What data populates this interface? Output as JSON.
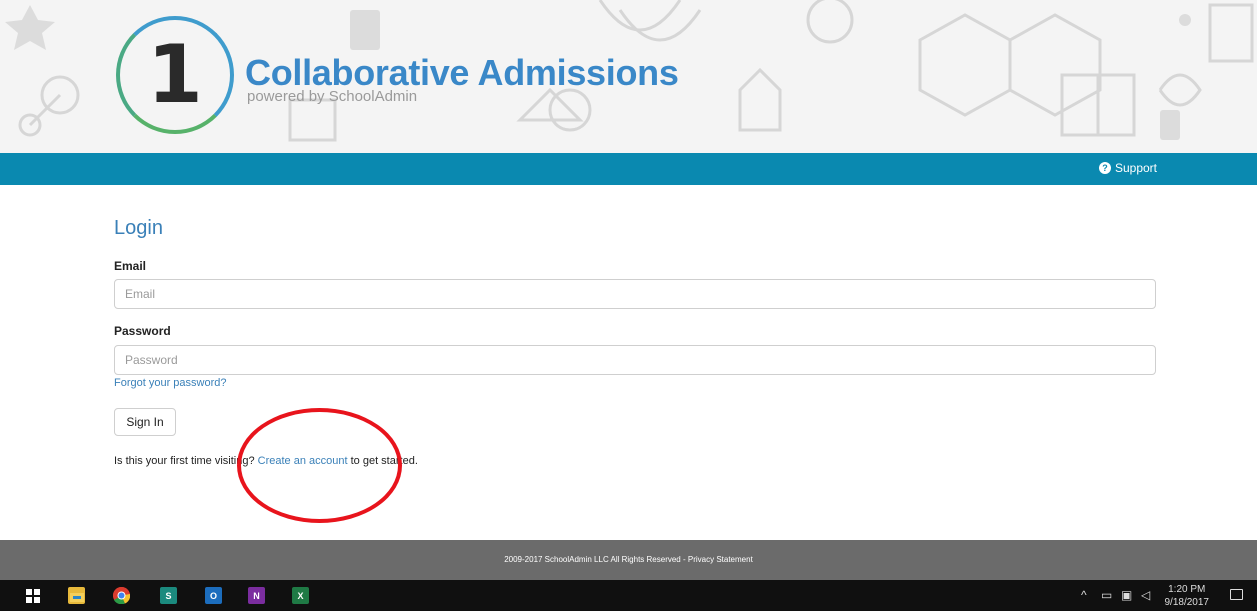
{
  "brand": {
    "logo_number": "1",
    "title": "Collaborative Admissions",
    "subtitle": "powered by SchoolAdmin"
  },
  "nav": {
    "support_label": "Support",
    "support_icon": "question-circle-icon"
  },
  "login": {
    "title": "Login",
    "email_label": "Email",
    "email_placeholder": "Email",
    "email_value": "",
    "password_label": "Password",
    "password_placeholder": "Password",
    "password_value": "",
    "forgot_link": "Forgot your password?",
    "signin_button": "Sign In",
    "first_time_prefix": "Is this your first time visiting?",
    "create_account_link": "Create an account",
    "first_time_suffix": "to get started."
  },
  "footer": {
    "copyright": "2009-2017 SchoolAdmin LLC All Rights Reserved -",
    "privacy_link": "Privacy Statement"
  },
  "taskbar": {
    "apps": [
      {
        "name": "windows-start-icon",
        "label": ""
      },
      {
        "name": "file-explorer-icon",
        "label": ""
      },
      {
        "name": "chrome-icon",
        "label": ""
      },
      {
        "name": "sway-icon",
        "label": "S"
      },
      {
        "name": "outlook-icon",
        "label": "O"
      },
      {
        "name": "onenote-icon",
        "label": "N"
      },
      {
        "name": "excel-icon",
        "label": "X"
      }
    ],
    "time": "1:20 PM",
    "date": "9/18/2017"
  },
  "colors": {
    "brand_blue": "#3a88c8",
    "nav_teal": "#0a89b0",
    "footer_gray": "#6b6b6b",
    "annotation_red": "#e8141c"
  }
}
